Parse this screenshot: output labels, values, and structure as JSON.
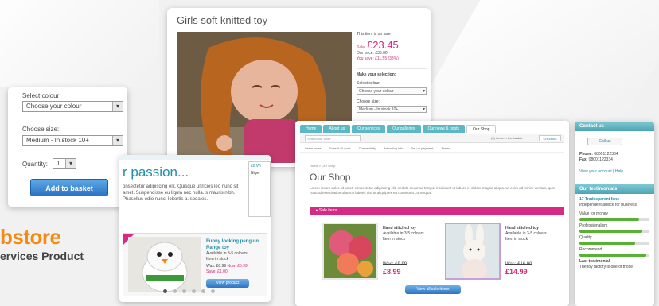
{
  "product_card": {
    "title": "Girls soft knitted toy",
    "on_sale": "This item is on sale",
    "sale_label": "Sale",
    "sale_price": "£23.45",
    "our_price_label": "Our price:",
    "our_price": "£35.00",
    "you_save_label": "You save:",
    "you_save": "£11.55 (33%)",
    "make_selection": "Make your selection:",
    "select_colour_label": "Select colour:",
    "colour_value": "Choose your colour",
    "choose_size_label": "Choose size:",
    "size_value": "Medium - In stock 10+"
  },
  "options_card": {
    "select_colour_label": "Select colour:",
    "colour_value": "Choose your colour",
    "choose_size_label": "Choose size:",
    "size_value": "Medium - In stock 10+",
    "quantity_label": "Quantity:",
    "quantity_value": "1",
    "add_button": "Add to basket"
  },
  "brand": {
    "name": "bstore",
    "sub": "ervices Product"
  },
  "passion_card": {
    "heading": "r passion...",
    "text": "onsectetur adipiscing elit. Quisque ultricies leo nunc sit amet. Suspendisse eu ligula nec nulla. s mauris nibh. Phasellus odio nunc, lobortis a. sodales.",
    "box_label": "£0 Wi",
    "box_sub": "Nigel",
    "slide_title": "Funny looking penguin Range toy",
    "slide_available": "Available in 3-5 colours",
    "slide_stock": "Item in stock",
    "slide_was": "Was: £6.99",
    "slide_now": "Now: £5.99",
    "slide_save": "Save: £1.00",
    "slide_button": "View product"
  },
  "shop_card": {
    "nav": [
      "Home",
      "About us",
      "Our services",
      "Our galleries",
      "Our news & posts",
      "Our Shop"
    ],
    "search_placeholder": "Search our store",
    "basket_text": "(0) items in the basket",
    "checkout": "Checkout",
    "subnav": [
      "Learn more",
      "Does it all work",
      "Connectivity",
      "Adjusting info",
      "Set up payment",
      "Terms"
    ],
    "breadcrumb": "Home > Our Shop",
    "title": "Our Shop",
    "intro": "Lorem ipsum dolor sit amet, consectetur adipiscing elit, sed do eiusmod tempor incididunt ut labore et dolore magna aliqua. Ut enim ad minim veniam, quis nostrud exercitation ullamco laboris nisi ut aliquip ex ea commodo consequat.",
    "sale_bar": "Sale items",
    "products": [
      {
        "name": "Hand stitched toy",
        "available": "Available in 3-5 colours",
        "stock": "Item in stock",
        "was": "Was: £9.99",
        "now": "£8.99"
      },
      {
        "name": "Hand stitched toy",
        "available": "Available in 3-5 colours",
        "stock": "Item in stock",
        "was": "Was: £16.99",
        "now": "£14.99"
      }
    ],
    "view_all": "View all sale items"
  },
  "right_card": {
    "contact_head": "Contact us",
    "phone_button": "Call us",
    "phone_label": "Phone:",
    "phone": "08001122334",
    "fax_label": "Fax:",
    "fax": "08001122334",
    "account_link": "View your account",
    "help_link": "Help",
    "testimonials_head": "Our testimonials",
    "testimonial_title": "17 Tradesparent fans",
    "testimonial_sub": "Independent advice for business",
    "bars": [
      {
        "label": "Value for money",
        "value": 0.85
      },
      {
        "label": "Professionalism",
        "value": 0.9
      },
      {
        "label": "Quality",
        "value": 0.8
      },
      {
        "label": "Recommend",
        "value": 0.95
      }
    ],
    "last_label": "Last testimonial",
    "last_text": "The toy factory is one of those"
  },
  "colors": {
    "accent_pink": "#d62a86",
    "accent_teal": "#1e8fa8",
    "brand_orange": "#f28a14",
    "button_blue": "#2b73c4"
  }
}
